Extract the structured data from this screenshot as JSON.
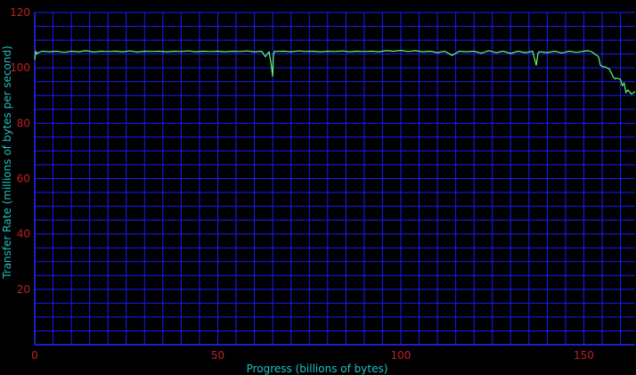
{
  "chart_data": {
    "type": "line",
    "title": "",
    "xlabel": "Progress (billions of bytes)",
    "ylabel": "Transfer Rate (millions of bytes per second)",
    "xlim": [
      0,
      164
    ],
    "ylim": [
      0,
      120
    ],
    "x_ticks": [
      0,
      50,
      100,
      150
    ],
    "x_tick_labels": [
      "0",
      "50",
      "100",
      "150"
    ],
    "y_ticks": [
      20,
      40,
      60,
      80,
      100,
      120
    ],
    "y_tick_labels": [
      "20",
      "40",
      "60",
      "80",
      "100",
      "120"
    ],
    "grid": true,
    "x_minor_step": 5,
    "y_minor_step": 5,
    "colors": {
      "background": "#000000",
      "grid": "#1a1aff",
      "axis": "#2a2aff",
      "line": "#66ff66",
      "tick_label": "#c02020",
      "axis_label": "#20c0c0"
    },
    "series": [
      {
        "x": [
          0,
          0.3,
          0.6,
          1,
          2,
          4,
          6,
          8,
          10,
          12,
          14,
          16,
          18,
          20,
          22,
          24,
          26,
          28,
          30,
          32,
          34,
          36,
          38,
          40,
          42,
          44,
          46,
          48,
          50,
          52,
          54,
          56,
          58,
          60,
          62,
          63,
          64,
          64.5,
          65,
          65.2,
          65.5,
          66,
          68,
          70,
          72,
          74,
          76,
          78,
          80,
          82,
          84,
          86,
          88,
          90,
          92,
          94,
          96,
          98,
          100,
          102,
          104,
          106,
          108,
          110,
          112,
          114,
          116,
          118,
          120,
          122,
          124,
          126,
          128,
          130,
          132,
          134,
          136,
          137,
          137.5,
          138,
          140,
          142,
          144,
          146,
          148,
          150,
          151,
          152,
          153,
          154,
          154.5,
          155,
          156,
          157,
          158,
          158.5,
          159,
          160,
          160.5,
          161,
          161.5,
          162,
          163,
          164
        ],
        "y": [
          103,
          106,
          105,
          105.5,
          106,
          105.8,
          106,
          105.6,
          106,
          105.8,
          106.2,
          105.7,
          106,
          105.9,
          106,
          105.8,
          106.1,
          105.7,
          106,
          105.9,
          106,
          105.8,
          106,
          105.9,
          106.1,
          105.8,
          106,
          105.9,
          106,
          105.8,
          106,
          105.9,
          106.1,
          105.8,
          106,
          104,
          105.8,
          102,
          97,
          105,
          106,
          105.9,
          106,
          105.8,
          106.1,
          105.9,
          106,
          105.8,
          106,
          105.9,
          106.1,
          105.8,
          106,
          105.9,
          106,
          105.8,
          106.2,
          106,
          106.3,
          105.9,
          106.2,
          105.8,
          106,
          105.5,
          106,
          104.5,
          106,
          105.8,
          106,
          105.3,
          106.2,
          105.5,
          106,
          105.2,
          106,
          105.5,
          106,
          101,
          105.5,
          105.8,
          105.5,
          106,
          105.4,
          106,
          105.6,
          106,
          106.2,
          105.9,
          105,
          104,
          101,
          100.5,
          100.2,
          99.5,
          96.8,
          96,
          96.3,
          95.8,
          93.5,
          94.5,
          91,
          92,
          90.5,
          91.5
        ]
      }
    ]
  }
}
